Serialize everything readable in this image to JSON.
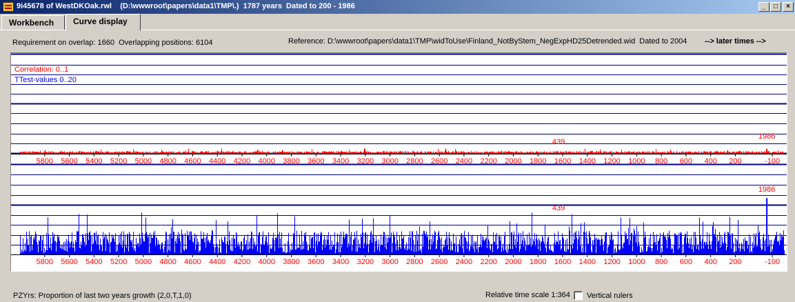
{
  "window": {
    "title": "9i45678 of WestDKOak.rwl    (D:\\wwwroot\\papers\\data1\\TMP\\.)  1787 years  Dated to 200 - 1986",
    "minimize_label": "_",
    "maximize_label": "□",
    "close_label": "×"
  },
  "tabs": [
    {
      "label": "Workbench"
    },
    {
      "label": "Curve display"
    }
  ],
  "header": {
    "overlap_info": "Requirement on overlap: 1660  Overlapping positions: 6104",
    "reference": "Reference: D:\\wwwroot\\papers\\data1\\TMP\\widToUse\\Finland_NotByStem_NegExpHD25Detrended.wid  Dated to 2004",
    "later_times": "--> later times -->"
  },
  "colors": {
    "correlation": "#ff0000",
    "ttest": "#0000ff",
    "grid": "#00008b",
    "axis_text": "#ff0000"
  },
  "chart_data": [
    {
      "type": "bar",
      "series_label": "Correlation: 0..1",
      "x_tick_labels": [
        "5800",
        "5600",
        "5400",
        "5200",
        "5000",
        "4800",
        "4600",
        "4400",
        "4200",
        "4000",
        "3800",
        "3600",
        "3400",
        "3200",
        "3000",
        "2800",
        "2600",
        "2400",
        "2200",
        "2000",
        "1800",
        "1600",
        "1400",
        "1200",
        "1000",
        "800",
        "600",
        "400",
        "200",
        "-100"
      ],
      "xlim": [
        6000,
        -200
      ],
      "ylim": [
        0,
        1
      ],
      "annotations": [
        {
          "text": "439",
          "x": 1600
        },
        {
          "text": "1986",
          "x": -100
        }
      ]
    },
    {
      "type": "bar",
      "series_label": "TTest-values 0..20",
      "x_tick_labels": [
        "5800",
        "5600",
        "5400",
        "5200",
        "5000",
        "4800",
        "4600",
        "4400",
        "4200",
        "4000",
        "3800",
        "3600",
        "3400",
        "3200",
        "3000",
        "2800",
        "2600",
        "2400",
        "2200",
        "2000",
        "1800",
        "1600",
        "1400",
        "1200",
        "1000",
        "800",
        "600",
        "400",
        "200",
        "-100"
      ],
      "xlim": [
        6000,
        -200
      ],
      "ylim": [
        0,
        20
      ],
      "annotations": [
        {
          "text": "439",
          "x": 1600
        },
        {
          "text": "1986",
          "x": -100
        }
      ]
    }
  ],
  "footer": {
    "pzyrs": "PZYrs: Proportion of last two years growth (2,0,T,1,0)",
    "time_scale": "Relative time scale 1:364",
    "vertical_rulers_label": "Vertical rulers",
    "vertical_rulers_checked": false
  }
}
